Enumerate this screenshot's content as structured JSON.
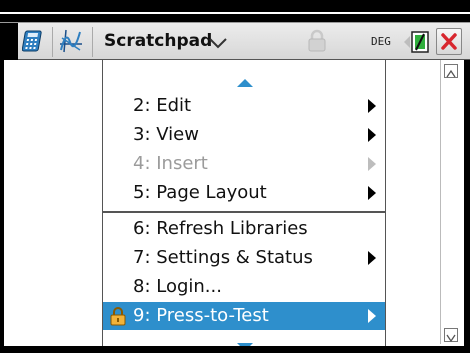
{
  "titlebar": {
    "document_title": "Scratchpad",
    "angle_mode": "DEG"
  },
  "icons": {
    "calculator": "calculator-app-icon",
    "graph": "graph-app-icon",
    "dropdown": "chevron-down-icon",
    "lock": "lock-icon",
    "battery": "battery-icon",
    "close": "close-icon",
    "scroll_up": "triangle-up-icon",
    "scroll_down": "triangle-down-icon"
  },
  "colors": {
    "selection": "#2e8fcc",
    "disabled_text": "#9b9b9b",
    "close_x": "#d8262e",
    "battery_green": "#2fae3c"
  },
  "menu": {
    "items": [
      {
        "label": "2: Edit",
        "has_submenu": true,
        "disabled": false,
        "selected": false
      },
      {
        "label": "3: View",
        "has_submenu": true,
        "disabled": false,
        "selected": false
      },
      {
        "label": "4: Insert",
        "has_submenu": true,
        "disabled": true,
        "selected": false
      },
      {
        "label": "5: Page Layout",
        "has_submenu": true,
        "disabled": false,
        "selected": false
      },
      {
        "label": "6: Refresh Libraries",
        "has_submenu": false,
        "disabled": false,
        "selected": false
      },
      {
        "label": "7: Settings & Status",
        "has_submenu": true,
        "disabled": false,
        "selected": false
      },
      {
        "label": "8: Login...",
        "has_submenu": false,
        "disabled": false,
        "selected": false
      },
      {
        "label": "9: Press-to-Test",
        "has_submenu": true,
        "disabled": false,
        "selected": true
      }
    ]
  }
}
